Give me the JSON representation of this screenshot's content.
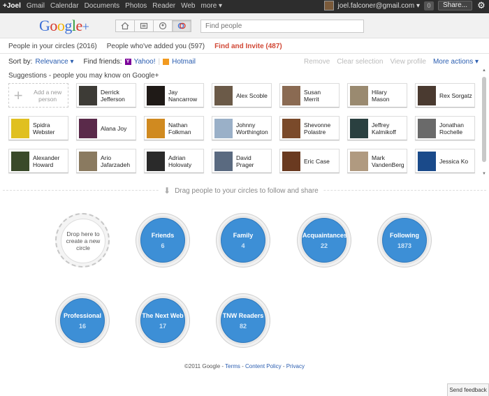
{
  "topbar": {
    "nav": [
      "+Joel",
      "Gmail",
      "Calendar",
      "Documents",
      "Photos",
      "Reader",
      "Web",
      "more ▾"
    ],
    "email": "joel.falconer@gmail.com ▾",
    "notifications": "0",
    "share": "Share..."
  },
  "header": {
    "logo_plus": "+",
    "search_placeholder": "Find people"
  },
  "tabs": [
    {
      "label": "People in your circles (2016)"
    },
    {
      "label": "People who've added you (597)"
    },
    {
      "label": "Find and Invite (487)"
    }
  ],
  "toolbar": {
    "sort_label": "Sort by:",
    "sort_value": "Relevance ▾",
    "find_label": "Find friends:",
    "yahoo": "Yahoo!",
    "hotmail": "Hotmail",
    "remove": "Remove",
    "clear": "Clear selection",
    "view_profile": "View profile",
    "more_actions": "More actions ▾"
  },
  "suggestions_title": "Suggestions - people you may know on Google+",
  "add_person": "Add a new person",
  "people": [
    {
      "name": "Derrick Jefferson",
      "color": "#3d3b36"
    },
    {
      "name": "Jay Nancarrow",
      "color": "#1f1a17"
    },
    {
      "name": "Alex Scoble",
      "color": "#6b5a48"
    },
    {
      "name": "Susan Merrit",
      "color": "#8a6a52"
    },
    {
      "name": "Hilary Mason",
      "color": "#9a8a70"
    },
    {
      "name": "Rex Sorgatz",
      "color": "#4a3a30"
    },
    {
      "name": "Spidra Webster",
      "color": "#e0c020"
    },
    {
      "name": "Alana Joy",
      "color": "#5a2a4a"
    },
    {
      "name": "Nathan Folkman",
      "color": "#d08a20"
    },
    {
      "name": "Johnny Worthington",
      "color": "#9ab0c8"
    },
    {
      "name": "Shevonne Polastre",
      "color": "#7a4a2a"
    },
    {
      "name": "Jeffrey Kalmikoff",
      "color": "#2a4040"
    },
    {
      "name": "Jonathan Rochelle",
      "color": "#6a6a6a"
    },
    {
      "name": "Alexander Howard",
      "color": "#3a4a2a"
    },
    {
      "name": "Ario Jafarzadeh",
      "color": "#8a7a60"
    },
    {
      "name": "Adrian Holovaty",
      "color": "#2a2a2a"
    },
    {
      "name": "David Prager",
      "color": "#5a6a80"
    },
    {
      "name": "Eric Case",
      "color": "#6a3a20"
    },
    {
      "name": "Mark VandenBerg",
      "color": "#b09a80"
    },
    {
      "name": "Jessica Ko",
      "color": "#1a4a8a"
    }
  ],
  "drag_text": "Drag people to your circles to follow and share",
  "drop_text": "Drop here to create a new circle",
  "circles": [
    {
      "name": "Friends",
      "count": "6"
    },
    {
      "name": "Family",
      "count": "4"
    },
    {
      "name": "Acquaintances",
      "count": "22"
    },
    {
      "name": "Following",
      "count": "1873"
    },
    {
      "name": "Professional",
      "count": "16"
    },
    {
      "name": "The Next Web",
      "count": "17"
    },
    {
      "name": "TNW Readers",
      "count": "82"
    }
  ],
  "footer": {
    "copyright": "©2011 Google - ",
    "terms": "Terms",
    "policy": "Content Policy",
    "privacy": "Privacy"
  },
  "send_feedback": "Send feedback",
  "colors": {
    "accent_red": "#d14836",
    "link_blue": "#2a5db0",
    "circle_blue": "#3d8fd6"
  }
}
